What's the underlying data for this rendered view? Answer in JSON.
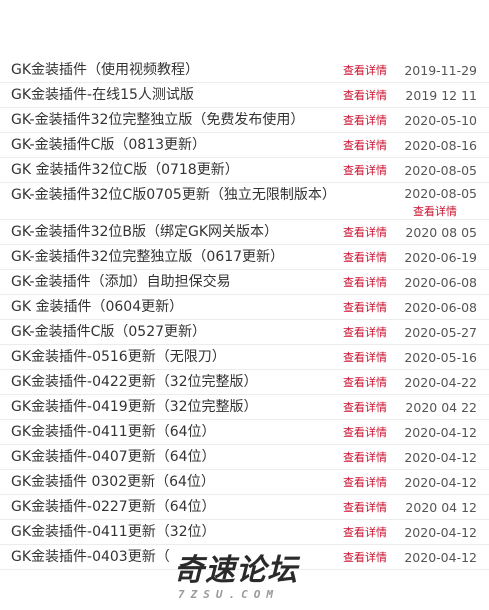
{
  "list": {
    "detail_label": "查看详情",
    "items": [
      {
        "title": "GK金装插件（使用视频教程）",
        "detail": "查看详情",
        "date": "2019-11-29"
      },
      {
        "title": "GK金装插件-在线15人测试版",
        "detail": "查看详情",
        "date": "2019 12 11"
      },
      {
        "title": "GK-金装插件32位完整独立版（免费发布使用）",
        "detail": "查看详情",
        "date": "2020-05-10"
      },
      {
        "title": "GK-金装插件C版（0813更新）",
        "detail": "查看详情",
        "date": "2020-08-16"
      },
      {
        "title": "GK 金装插件32位C版（0718更新）",
        "detail": "查看详情",
        "date": "2020-08-05"
      },
      {
        "title": "GK-金装插件32位C版0705更新（独立无限制版本）",
        "detail": "查看详情",
        "date": "2020-08-05"
      },
      {
        "title": "GK-金装插件32位B版（绑定GK网关版本）",
        "detail": "查看详情",
        "date": "2020 08 05"
      },
      {
        "title": "GK-金装插件32位完整独立版（0617更新）",
        "detail": "查看详情",
        "date": "2020-06-19"
      },
      {
        "title": "GK-金装插件（添加）自助担保交易",
        "detail": "查看详情",
        "date": "2020-06-08"
      },
      {
        "title": "GK 金装插件（0604更新）",
        "detail": "查看详情",
        "date": "2020-06-08"
      },
      {
        "title": "GK-金装插件C版（0527更新）",
        "detail": "查看详情",
        "date": "2020-05-27"
      },
      {
        "title": "GK金装插件-0516更新（无限刀）",
        "detail": "查看详情",
        "date": "2020-05-16"
      },
      {
        "title": "GK金装插件-0422更新（32位完整版）",
        "detail": "查看详情",
        "date": "2020-04-22"
      },
      {
        "title": "GK金装插件-0419更新（32位完整版）",
        "detail": "查看详情",
        "date": "2020 04 22"
      },
      {
        "title": "GK金装插件-0411更新（64位）",
        "detail": "查看详情",
        "date": "2020-04-12"
      },
      {
        "title": "GK金装插件-0407更新（64位）",
        "detail": "查看详情",
        "date": "2020-04-12"
      },
      {
        "title": "GK金装插件 0302更新（64位）",
        "detail": "查看详情",
        "date": "2020-04-12"
      },
      {
        "title": "GK金装插件-0227更新（64位）",
        "detail": "查看详情",
        "date": "2020 04 12"
      },
      {
        "title": "GK金装插件-0411更新（32位）",
        "detail": "查看详情",
        "date": "2020-04-12"
      },
      {
        "title": "GK金装插件-0403更新（",
        "detail": "查看详情",
        "date": "2020-04-12"
      }
    ]
  },
  "watermark": {
    "main": "奇速论坛",
    "sub": "7ZSU.COM"
  },
  "colors": {
    "detail_link": "#c8102e",
    "text": "#333333",
    "divider": "#ececec"
  }
}
